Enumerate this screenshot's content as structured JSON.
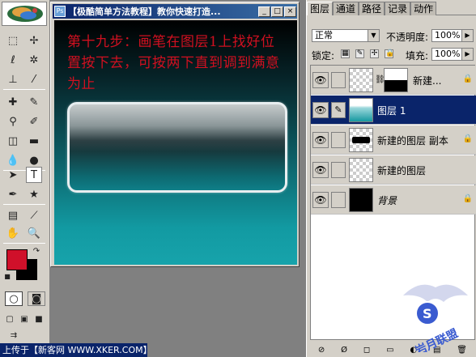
{
  "document": {
    "title": "【极酷简单方法教程】教你快速打造...",
    "window_buttons": [
      "_",
      "□",
      "×"
    ],
    "instruction": "第十九步：画笔在图层1上找好位置按下去，可按两下直到调到满意为止"
  },
  "toolbox": {
    "foreground_color": "#d0102a",
    "background_color": "#000000"
  },
  "layers_panel": {
    "tabs": [
      "图层",
      "通道",
      "路径",
      "记录",
      "动作"
    ],
    "blend_mode": "正常",
    "opacity_label": "不透明度:",
    "opacity_value": "100%",
    "lock_label": "锁定:",
    "fill_label": "填充:",
    "fill_value": "100%",
    "layers": [
      {
        "name": "新建...",
        "visible": true,
        "selected": false,
        "thumb": "checker",
        "has_mask": true
      },
      {
        "name": "图层 1",
        "visible": true,
        "selected": true,
        "thumb": "teal"
      },
      {
        "name": "新建的图层 副本",
        "visible": true,
        "selected": false,
        "thumb": "black-bar"
      },
      {
        "name": "新建的图层",
        "visible": true,
        "selected": false,
        "thumb": "checker"
      },
      {
        "name": "背景",
        "visible": true,
        "selected": false,
        "thumb": "black",
        "locked": true
      }
    ]
  },
  "status": {
    "text": "上传于【新客网 WWW.XKER.COM】"
  },
  "watermark": {
    "text": "岩月联盟"
  },
  "colors": {
    "accent": "#0a246a",
    "panel": "#d4d0c8",
    "instruction_text": "#d01020"
  }
}
